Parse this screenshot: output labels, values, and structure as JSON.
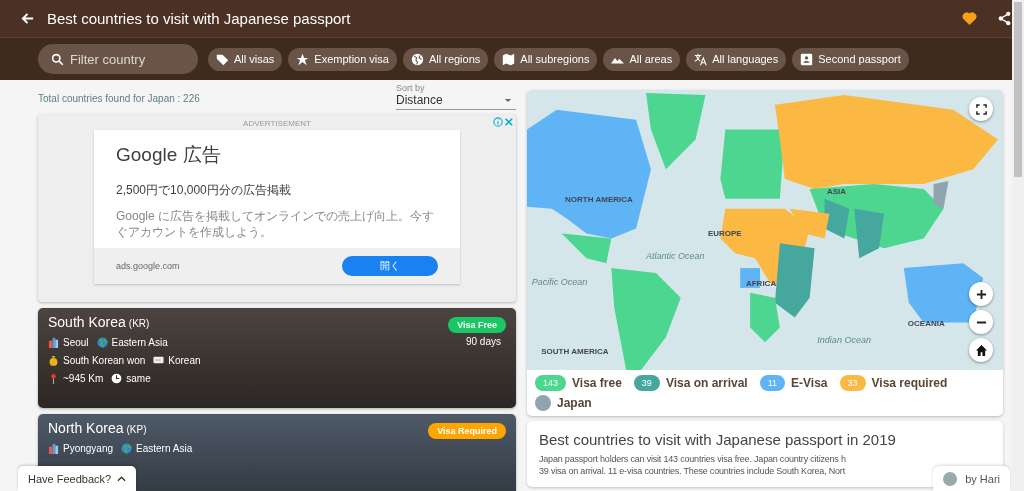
{
  "header": {
    "title": "Best countries to visit with Japanese passport",
    "favorite": true
  },
  "filters": {
    "search_placeholder": "Filter country",
    "chips": [
      "All visas",
      "Exemption visa",
      "All regions",
      "All subregions",
      "All areas",
      "All languages",
      "Second passport"
    ]
  },
  "results": {
    "total": "Total countries found for Japan : 226",
    "sort_label": "Sort by",
    "sort_value": "Distance"
  },
  "ad": {
    "label": "ADVERTISEMENT",
    "title": "Google 広告",
    "headline": "2,500円で10,000円分の広告掲載",
    "body": "Google に広告を掲載してオンラインでの売上げ向上。今すぐアカウントを作成しよう。",
    "domain": "ads.google.com",
    "button": "開く"
  },
  "countries": [
    {
      "name": "South Korea",
      "code": "(KR)",
      "color": "#19c865",
      "badge": "Visa Free",
      "duration": "90 days",
      "capital": "Seoul",
      "region": "Eastern Asia",
      "currency": "South Korean won",
      "language": "Korean",
      "distance": "~945 Km",
      "time": "same"
    },
    {
      "name": "North Korea",
      "code": "(KP)",
      "color": "#ffa500",
      "badge": "Visa Required",
      "capital": "Pyongyang",
      "region": "Eastern Asia"
    }
  ],
  "map": {
    "labels": [
      {
        "kind": "continent",
        "text": "NORTH AMERICA"
      },
      {
        "kind": "continent",
        "text": "EUROPE"
      },
      {
        "kind": "continent",
        "text": "ASIA"
      },
      {
        "kind": "ocean",
        "text": "Atlantic Ocean"
      },
      {
        "kind": "ocean",
        "text": "Pacific Ocean"
      },
      {
        "kind": "continent",
        "text": "AFRICA"
      },
      {
        "kind": "ocean",
        "text": "Indian Ocean"
      },
      {
        "kind": "continent",
        "text": "SOUTH AMERICA"
      },
      {
        "kind": "continent",
        "text": "OCEANIA"
      }
    ]
  },
  "legend": [
    {
      "count": "143",
      "label": "Visa free",
      "color": "#4cd68f"
    },
    {
      "count": "39",
      "label": "Visa on arrival",
      "color": "#45a79d"
    },
    {
      "count": "11",
      "label": "E-Visa",
      "color": "#5eb4f5"
    },
    {
      "count": "33",
      "label": "Visa required",
      "color": "#fbb944"
    },
    {
      "label": "Japan",
      "color": "#90a4ae"
    }
  ],
  "article": {
    "title": "Best countries to visit with Japanese passport in 2019",
    "lines": [
      "Japan passport holders can visit 143 countries visa free. Japan country citizens h",
      "39 visa on arrival. 11 e-visa countries. These countries include South Korea, Nort"
    ]
  },
  "feedback": "Have Feedback?",
  "author": "by Hari"
}
